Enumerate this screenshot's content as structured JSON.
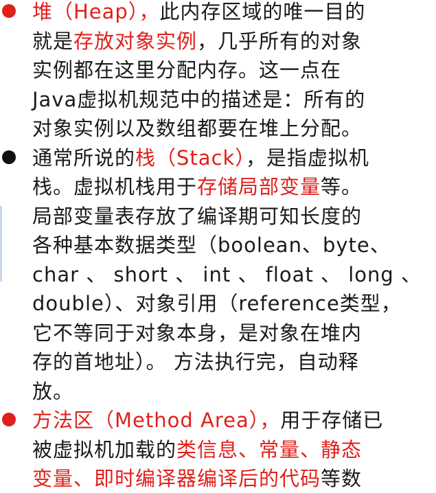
{
  "colors": {
    "text": "#1a1a1a",
    "accent": "#e0201b",
    "bullet_red": "#e0201b",
    "bullet_black": "#111111"
  },
  "bullets": [
    {
      "bullet_color": "red",
      "lines": [
        [
          {
            "t": "堆（Heap），",
            "c": "red"
          },
          {
            "t": "此内存区域的唯一目的",
            "c": "black"
          }
        ],
        [
          {
            "t": "就是",
            "c": "black"
          },
          {
            "t": "存放对象实例",
            "c": "red"
          },
          {
            "t": "，几乎所有的对象",
            "c": "black"
          }
        ],
        [
          {
            "t": "实例都在这里分配内存。这一点在",
            "c": "black"
          }
        ],
        [
          {
            "t": "Java虚拟机规范中的描述是：所有的",
            "c": "black"
          }
        ],
        [
          {
            "t": "对象实例以及数组都要在堆上分配。",
            "c": "black"
          }
        ]
      ]
    },
    {
      "bullet_color": "black",
      "lines": [
        [
          {
            "t": "通常所说的",
            "c": "black"
          },
          {
            "t": "栈（Stack）",
            "c": "red"
          },
          {
            "t": "，是指虚拟机",
            "c": "black"
          }
        ],
        [
          {
            "t": "栈。虚拟机栈用于",
            "c": "black"
          },
          {
            "t": "存储局部变量",
            "c": "red"
          },
          {
            "t": "等。",
            "c": "black"
          }
        ],
        [
          {
            "t": "局部变量表存放了编译期可知长度的",
            "c": "black"
          }
        ],
        [
          {
            "t": "各种基本数据类型（boolean、byte、",
            "c": "black"
          }
        ],
        [
          {
            "t": "char 、 short 、 int 、 float 、 long 、",
            "c": "black"
          }
        ],
        [
          {
            "t": "double）、对象引用（reference类型，",
            "c": "black"
          }
        ],
        [
          {
            "t": "它不等同于对象本身，是对象在堆内",
            "c": "black"
          }
        ],
        [
          {
            "t": "存的首地址）。 方法执行完，自动释",
            "c": "black"
          }
        ],
        [
          {
            "t": "放。",
            "c": "black"
          }
        ]
      ]
    },
    {
      "bullet_color": "red",
      "lines": [
        [
          {
            "t": "方法区（Method Area），",
            "c": "red"
          },
          {
            "t": "用于存储已",
            "c": "black"
          }
        ],
        [
          {
            "t": "被虚拟机加载的",
            "c": "black"
          },
          {
            "t": "类信息、常量、静态",
            "c": "red"
          }
        ],
        [
          {
            "t": "变量、即时编译器编译后的代码",
            "c": "red"
          },
          {
            "t": "等数",
            "c": "black"
          }
        ]
      ]
    }
  ]
}
